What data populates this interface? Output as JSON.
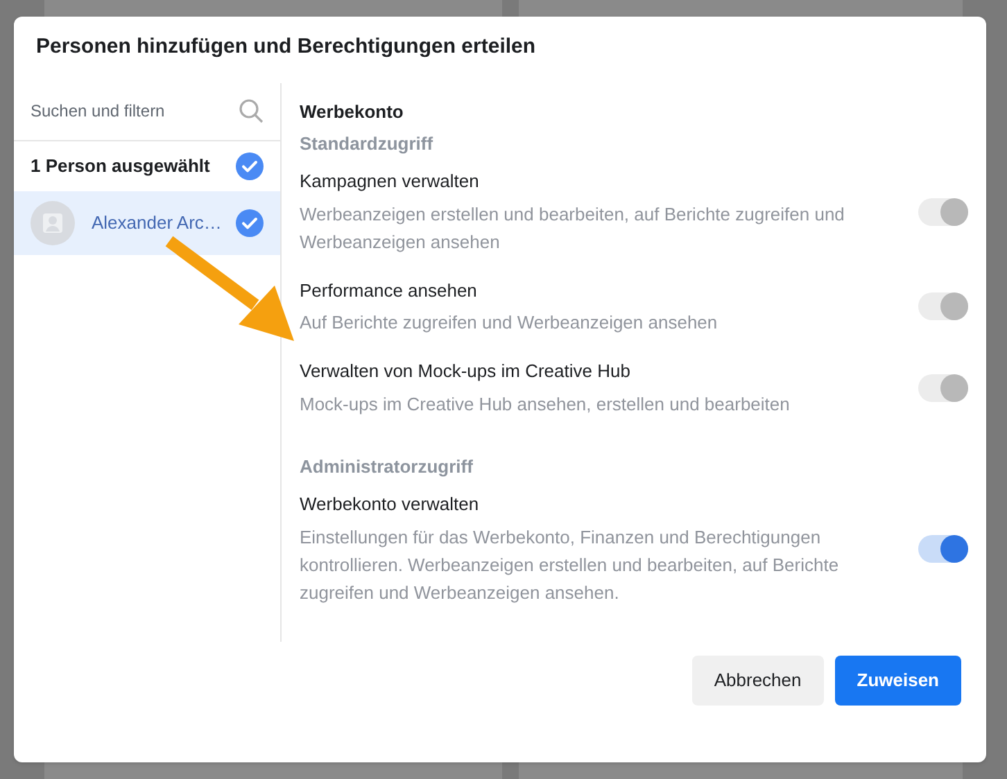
{
  "dialog": {
    "title": "Personen hinzufügen und Berechtigungen erteilen"
  },
  "sidebar": {
    "search": {
      "placeholder": "Suchen und filtern"
    },
    "selected_count": "1 Person ausgewählt",
    "count_checked": true,
    "people": [
      {
        "name": "Alexander Arc…",
        "selected": true,
        "checked": true
      }
    ]
  },
  "account": {
    "title": "Werbekonto",
    "sections": [
      {
        "heading": "Standardzugriff",
        "permissions": [
          {
            "title": "Kampagnen verwalten",
            "description": "Werbeanzeigen erstellen und bearbeiten, auf Berichte zugreifen und Werbeanzeigen ansehen",
            "on": true,
            "disabled": true
          },
          {
            "title": "Performance ansehen",
            "description": "Auf Berichte zugreifen und Werbeanzeigen ansehen",
            "on": true,
            "disabled": true
          },
          {
            "title": "Verwalten von Mock-ups im Creative Hub",
            "description": "Mock-ups im Creative Hub ansehen, erstellen und bearbeiten",
            "on": true,
            "disabled": true
          }
        ]
      },
      {
        "heading": "Administratorzugriff",
        "permissions": [
          {
            "title": "Werbekonto verwalten",
            "description": "Einstellungen für das Werbekonto, Finanzen und Berechtigungen kontrollieren. Werbeanzeigen erstellen und bearbeiten, auf Berichte zugreifen und Werbeanzeigen ansehen.",
            "on": true,
            "disabled": false
          }
        ]
      }
    ]
  },
  "buttons": [
    {
      "label": "Abbrechen",
      "kind": "secondary"
    },
    {
      "label": "Zuweisen",
      "kind": "primary"
    }
  ]
}
